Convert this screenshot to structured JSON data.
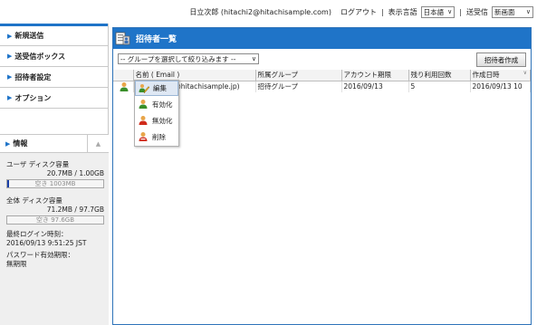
{
  "header": {
    "user": "日立次郎 (hitachi2@hitachisample.com)",
    "logout": "ログアウト",
    "language_label": "表示言語",
    "language_value": "日本語",
    "send_label": "送受信",
    "send_value": "新画面"
  },
  "sidebar": {
    "items": [
      {
        "label": "新規送信"
      },
      {
        "label": "送受信ボックス"
      },
      {
        "label": "招待者設定"
      },
      {
        "label": "オプション"
      }
    ],
    "info": {
      "title": "情報",
      "user_disk_label": "ユーザ ディスク容量",
      "user_disk_value": "20.7MB / 1.00GB",
      "user_disk_free": "空き 1003MB",
      "user_disk_used_fraction": 0.02,
      "total_disk_label": "全体 ディスク容量",
      "total_disk_value": "71.2MB / 97.7GB",
      "total_disk_free": "空き 97.6GB",
      "total_disk_used_fraction": 0.0,
      "last_login_label": "最終ログイン時刻：",
      "last_login_value": "2016/09/13 9:51:25 JST",
      "pw_expiry_label": "パスワード有効期限：",
      "pw_expiry_value": "無期限"
    }
  },
  "main": {
    "title": "招待者一覧",
    "group_filter": "-- グループを選択して絞り込みます --",
    "create_button": "招待者作成",
    "columns": [
      "",
      "名前 ( Email )",
      "所属グループ",
      "アカウント期限",
      "残り利用回数",
      "作成日時"
    ],
    "sort_glyph": "∨",
    "rows": [
      {
        "name": "1@hitachisample.jp)",
        "group": "招待グループ",
        "expiry": "2016/09/13",
        "remaining": "5",
        "created": "2016/09/13 10"
      }
    ]
  },
  "context_menu": {
    "items": [
      {
        "label": "編集",
        "icon": "edit-pencil-icon"
      },
      {
        "label": "有効化",
        "icon": "enable-user-icon"
      },
      {
        "label": "無効化",
        "icon": "disable-user-icon"
      },
      {
        "label": "削除",
        "icon": "delete-user-icon"
      }
    ]
  },
  "colors": {
    "accent": "#1f74c8",
    "disk_fill": "#1a3fa8",
    "user_icon_green": "#3a8f2a",
    "user_icon_red": "#d02a1a",
    "pencil_yellow": "#e7b12a"
  }
}
